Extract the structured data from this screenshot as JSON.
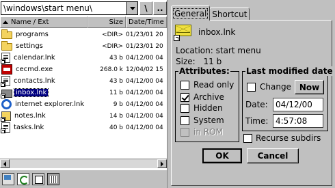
{
  "explorer": {
    "path": "\\windows\\start menu\\",
    "root_button": "\\",
    "up_button": "..",
    "columns": {
      "name": "Name / Ext",
      "size": "Size",
      "date": "Date/Time"
    },
    "files": [
      {
        "name": "programs",
        "size": "<DIR>",
        "date": "01/23/01 20",
        "icon": "folder-icon"
      },
      {
        "name": "settings",
        "size": "<DIR>",
        "date": "01/23/01 20",
        "icon": "folder-icon"
      },
      {
        "name": "calendar.lnk",
        "size": "43 b",
        "date": "04/12/00 04",
        "icon": "shortcut-file-icon"
      },
      {
        "name": "cecmd.exe",
        "size": "268.0 k",
        "date": "12/04/02 15",
        "icon": "exe-icon"
      },
      {
        "name": "contacts.lnk",
        "size": "43 b",
        "date": "04/12/00 04",
        "icon": "shortcut-file-icon"
      },
      {
        "name": "inbox.lnk",
        "size": "11 b",
        "date": "04/12/00 04",
        "icon": "mail-shortcut-icon",
        "selected": true
      },
      {
        "name": "internet explorer.lnk",
        "size": "9 b",
        "date": "04/12/00 04",
        "icon": "ie-icon"
      },
      {
        "name": "notes.lnk",
        "size": "14 b",
        "date": "04/12/00 04",
        "icon": "notes-shortcut-icon"
      },
      {
        "name": "tasks.lnk",
        "size": "40 b",
        "date": "04/12/00 04",
        "icon": "shortcut-file-icon"
      }
    ]
  },
  "properties": {
    "tabs": [
      "General",
      "Shortcut"
    ],
    "file_name": "inbox.lnk",
    "location_label": "Location:",
    "location": "start menu",
    "size_label": "Size:",
    "size": "11 b",
    "attributes_title": "Attributes:",
    "attributes": [
      {
        "label": "Read only",
        "checked": false,
        "disabled": false
      },
      {
        "label": "Archive",
        "checked": true,
        "disabled": false
      },
      {
        "label": "Hidden",
        "checked": false,
        "disabled": false
      },
      {
        "label": "System",
        "checked": false,
        "disabled": false
      },
      {
        "label": "in ROM",
        "checked": false,
        "disabled": true
      }
    ],
    "modified_title": "Last modified date",
    "change_label": "Change",
    "now_button": "Now",
    "date_label": "Date:",
    "date_value": "04/12/00",
    "time_label": "Time:",
    "time_value": "4:57:08",
    "recurse_label": "Recurse subdirs",
    "ok_button": "OK",
    "cancel_button": "Cancel"
  }
}
